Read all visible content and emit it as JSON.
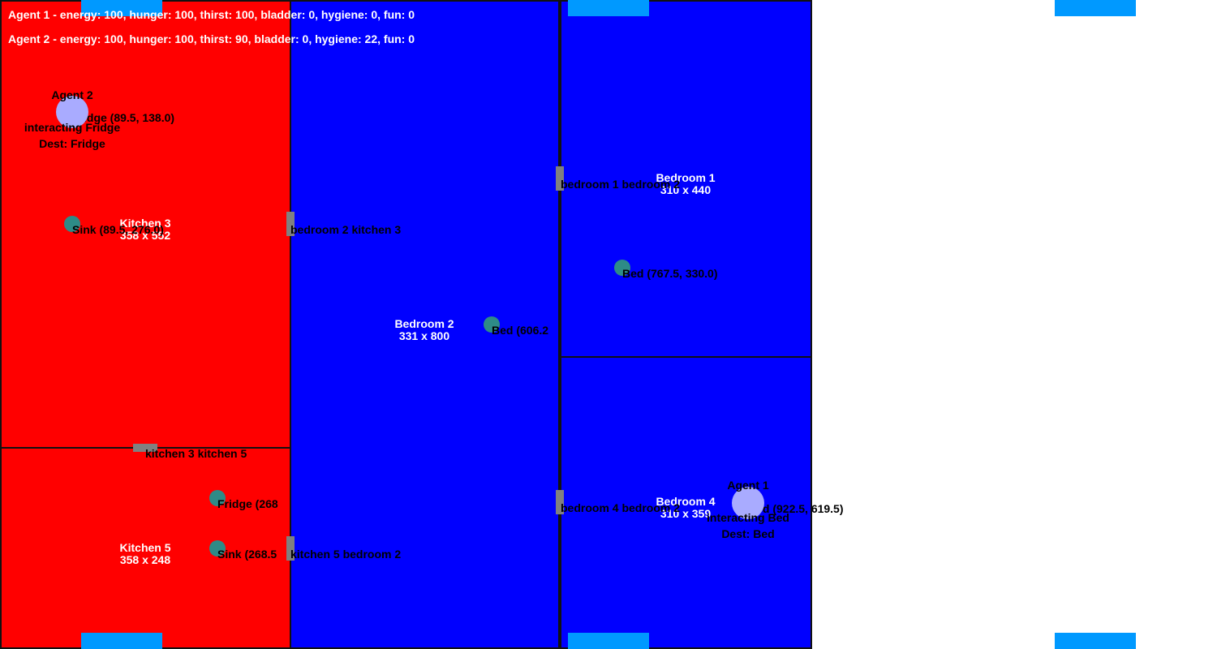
{
  "hud": {
    "agent1_status": "Agent 1 - energy: 100, hunger: 100, thirst: 100, bladder: 0, hygiene: 0, fun: 0",
    "agent2_status": "Agent 2 - energy: 100, hunger: 100, thirst: 90, bladder: 0, hygiene: 22, fun: 0"
  },
  "colors": {
    "kitchen": "#ff0000",
    "bedroom": "#0000ff",
    "door": "#808080",
    "object": "#2e8b87",
    "agent": "#a9abff",
    "spawn_pad": "#0099ff"
  },
  "rooms": {
    "kitchen3": {
      "name": "Kitchen 3",
      "size": "358 x 552"
    },
    "kitchen5": {
      "name": "Kitchen 5",
      "size": "358 x 248"
    },
    "bedroom2": {
      "name": "Bedroom 2",
      "size": "331 x 800"
    },
    "bedroom1": {
      "name": "Bedroom 1",
      "size": "310 x 440"
    },
    "bedroom4": {
      "name": "Bedroom 4",
      "size": "310 x 359"
    }
  },
  "doors": {
    "bedroom2_kitchen3": "bedroom 2 kitchen 3",
    "bedroom1_bedroom2": "bedroom 1 bedroom 2",
    "kitchen3_kitchen5": "kitchen 3 kitchen 5",
    "bedroom4_bedroom2": "bedroom 4 bedroom 2",
    "kitchen5_bedroom2": "kitchen 5 bedroom 2"
  },
  "objects": {
    "fridge_k3": "Fridge (89.5, 138.0)",
    "sink_k3": "Sink (89.5, 276.0)",
    "bed_b2": "Bed (606.2",
    "bed_b1": "Bed (767.5, 330.0)",
    "fridge_k5": "Fridge (268",
    "sink_k5": "Sink (268.5",
    "bed_b4": "Bed (922.5, 619.5)"
  },
  "agents": {
    "agent2": {
      "name": "Agent 2",
      "status": "interacting Fridge",
      "dest": "Dest: Fridge"
    },
    "agent1": {
      "name": "Agent 1",
      "status": "interacting Bed",
      "dest": "Dest: Bed"
    }
  }
}
